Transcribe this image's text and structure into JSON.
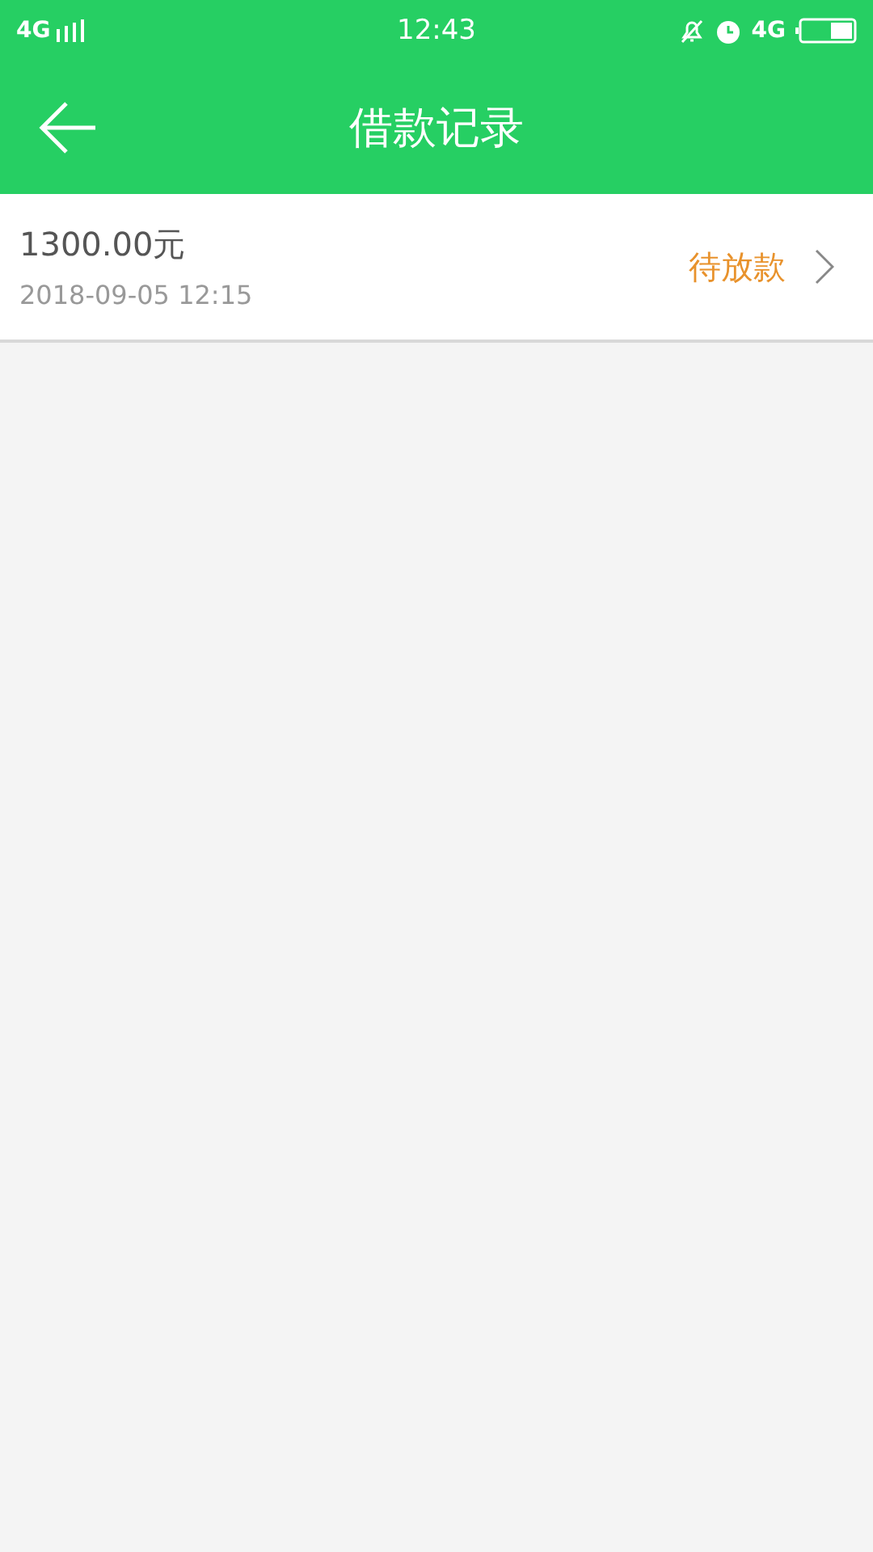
{
  "status_bar": {
    "network": "4G",
    "time": "12:43",
    "network_right": "4G"
  },
  "header": {
    "title": "借款记录"
  },
  "records": [
    {
      "amount": "1300.00元",
      "date": "2018-09-05 12:15",
      "status": "待放款"
    }
  ]
}
